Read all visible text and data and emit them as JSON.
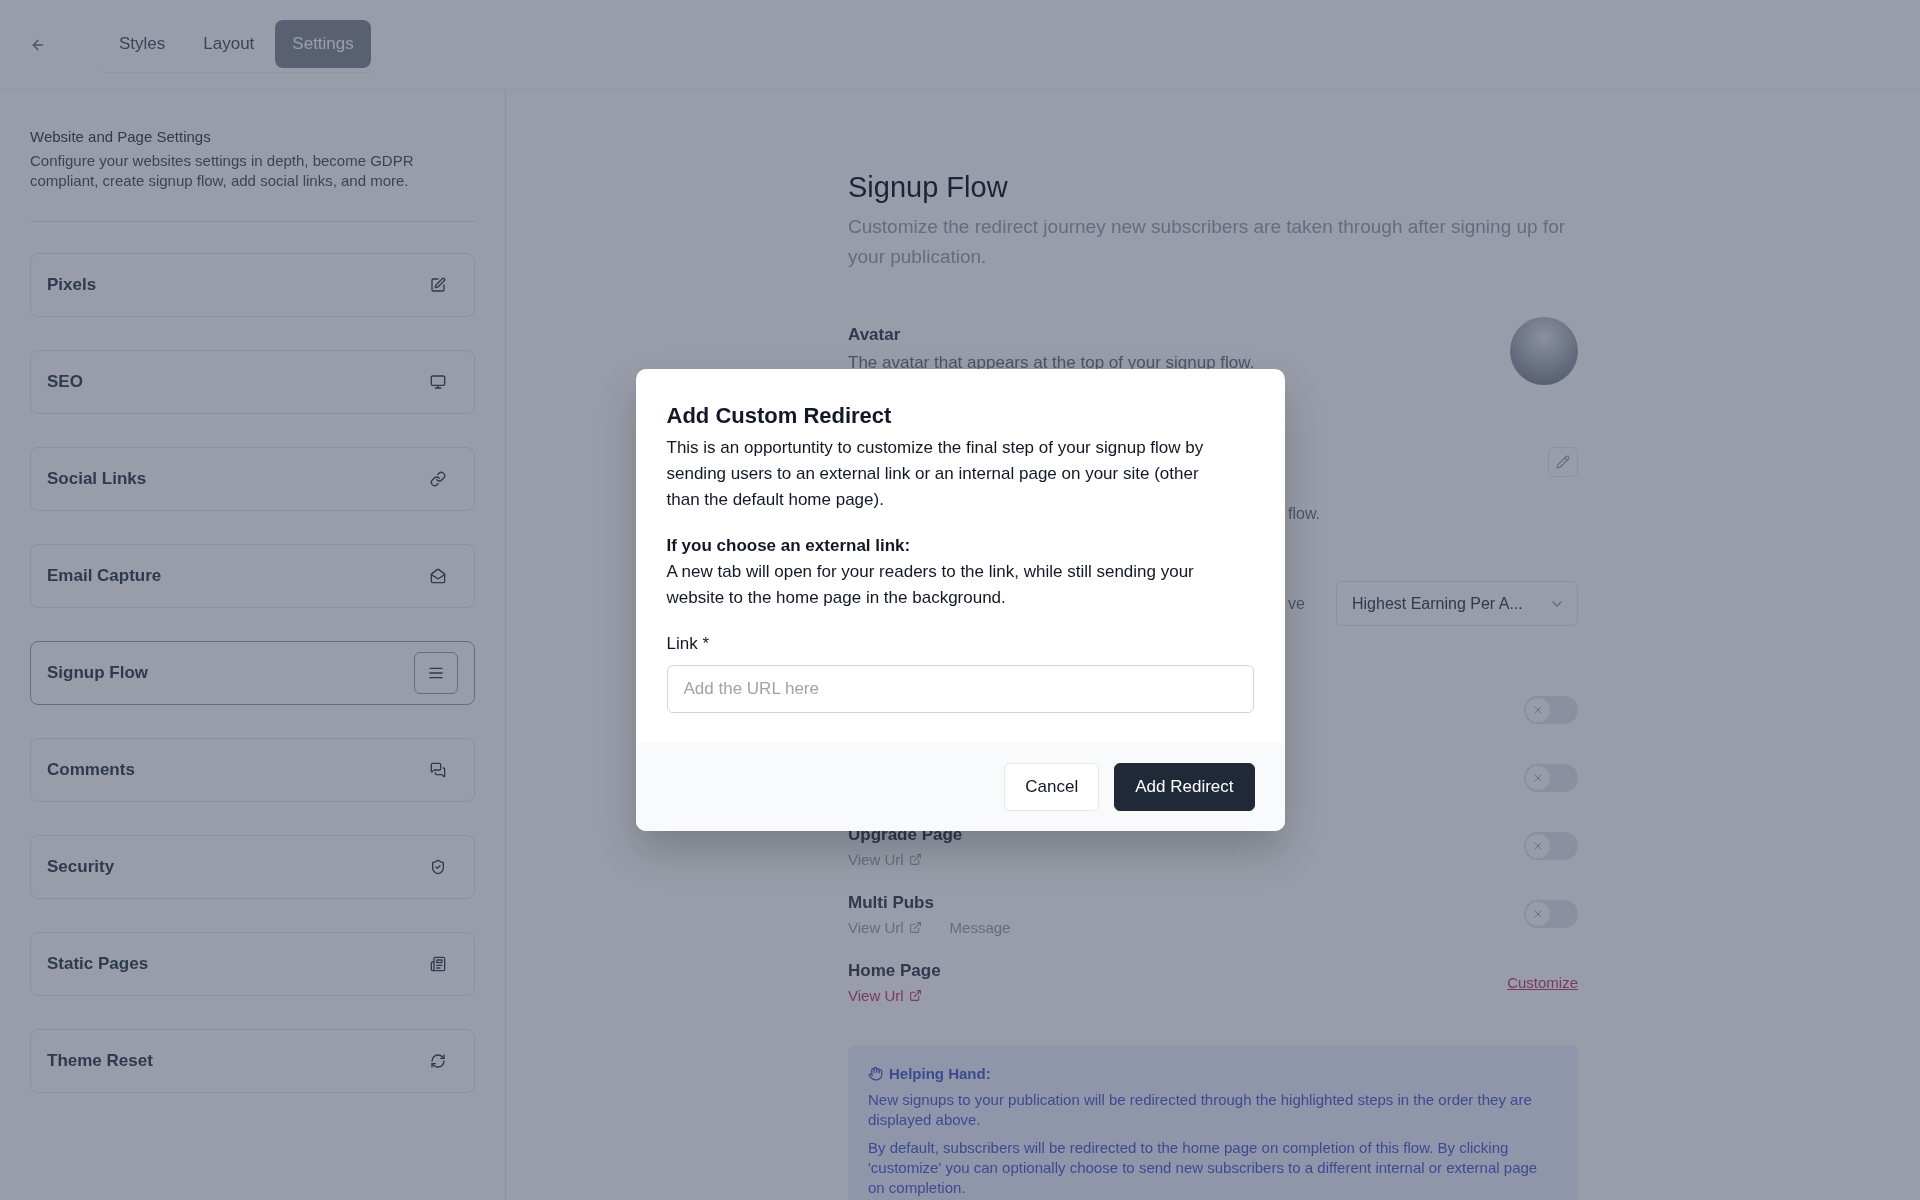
{
  "tabs": [
    {
      "label": "Styles",
      "selected": false
    },
    {
      "label": "Layout",
      "selected": false
    },
    {
      "label": "Settings",
      "selected": true
    }
  ],
  "sidebar": {
    "title": "Website and Page Settings",
    "description": "Configure your websites settings in depth, become GDPR compliant, create signup flow, add social links, and more.",
    "items": [
      {
        "label": "Pixels",
        "selected": false
      },
      {
        "label": "SEO",
        "selected": false
      },
      {
        "label": "Social Links",
        "selected": false
      },
      {
        "label": "Email Capture",
        "selected": false
      },
      {
        "label": "Signup Flow",
        "selected": true
      },
      {
        "label": "Comments",
        "selected": false
      },
      {
        "label": "Security",
        "selected": false
      },
      {
        "label": "Static Pages",
        "selected": false
      },
      {
        "label": "Theme Reset",
        "selected": false
      }
    ]
  },
  "main": {
    "title": "Signup Flow",
    "description": "Customize the redirect journey new subscribers are taken through after signing up for your publication.",
    "avatar": {
      "title": "Avatar",
      "description": "The avatar that appears at the top of your signup flow."
    },
    "edit_row": {
      "description_fragment": "flow."
    },
    "select_row": {
      "label_fragment": "ve",
      "value": "Highest Earning Per A..."
    },
    "steps": [
      {
        "kind": "toggle",
        "on": false
      },
      {
        "kind": "toggle",
        "on": false
      },
      {
        "kind": "toggle",
        "title": "Upgrade Page",
        "link": "View Url",
        "on": false
      },
      {
        "kind": "toggle",
        "title": "Multi Pubs",
        "link": "View Url",
        "extra": "Message",
        "on": false
      },
      {
        "kind": "customize",
        "title": "Home Page",
        "link": "View Url",
        "action": "Customize"
      }
    ],
    "helping_hand": {
      "title": "Helping Hand:",
      "paragraphs": [
        "New signups to your publication will be redirected through the highlighted steps in the order they are displayed above.",
        "By default, subscribers will be redirected to the home page on completion of this flow. By clicking 'customize' you can optionally choose to send new subscribers to a different internal or external page on completion."
      ]
    }
  },
  "modal": {
    "title": "Add Custom Redirect",
    "intro": "This is an opportuntity to customize the final step of your signup flow by sending users to an external link or an internal page on your site (other than the default home page).",
    "note_title": "If you choose an external link:",
    "note": "A new tab will open for your readers to the link, while still sending your website to the home page in the background.",
    "field_label": "Link *",
    "placeholder": "Add the URL here",
    "buttons": [
      {
        "label": "Cancel",
        "kind": "secondary"
      },
      {
        "label": "Add Redirect",
        "kind": "primary"
      }
    ]
  }
}
